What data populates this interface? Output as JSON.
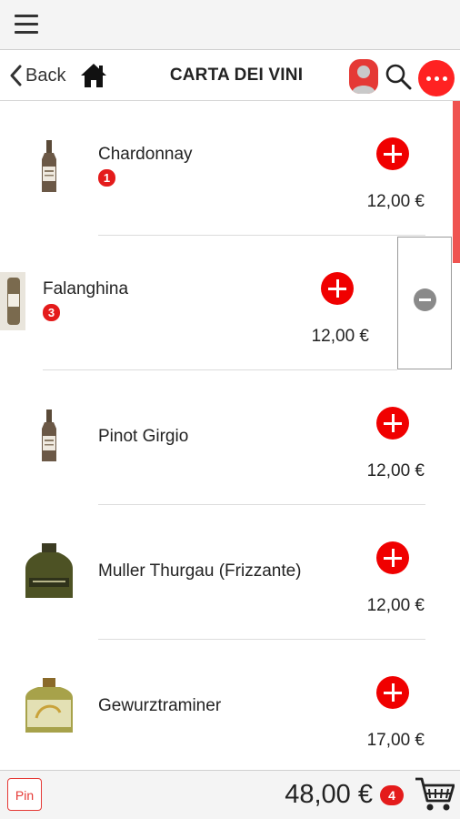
{
  "header": {
    "title": "CARTA DEI VINI",
    "back_label": "Back"
  },
  "items": [
    {
      "name": "Chardonnay",
      "qty": "1",
      "price": "12,00 €",
      "bottle": "tall-dark"
    },
    {
      "name": "Falanghina",
      "qty": "3",
      "price": "12,00 €",
      "bottle": "swiped"
    },
    {
      "name": "Pinot Girgio",
      "qty": "",
      "price": "12,00 €",
      "bottle": "tall-dark"
    },
    {
      "name": "Muller Thurgau (Frizzante)",
      "qty": "",
      "price": "12,00 €",
      "bottle": "green-squat"
    },
    {
      "name": "Gewurztraminer",
      "qty": "",
      "price": "17,00 €",
      "bottle": "gold-label"
    }
  ],
  "footer": {
    "pin_label": "Pin",
    "total": "48,00 €",
    "cart_count": "4"
  },
  "colors": {
    "accent": "#f00000",
    "badge": "#e41b1b",
    "topbar": "#f4f4f4"
  }
}
